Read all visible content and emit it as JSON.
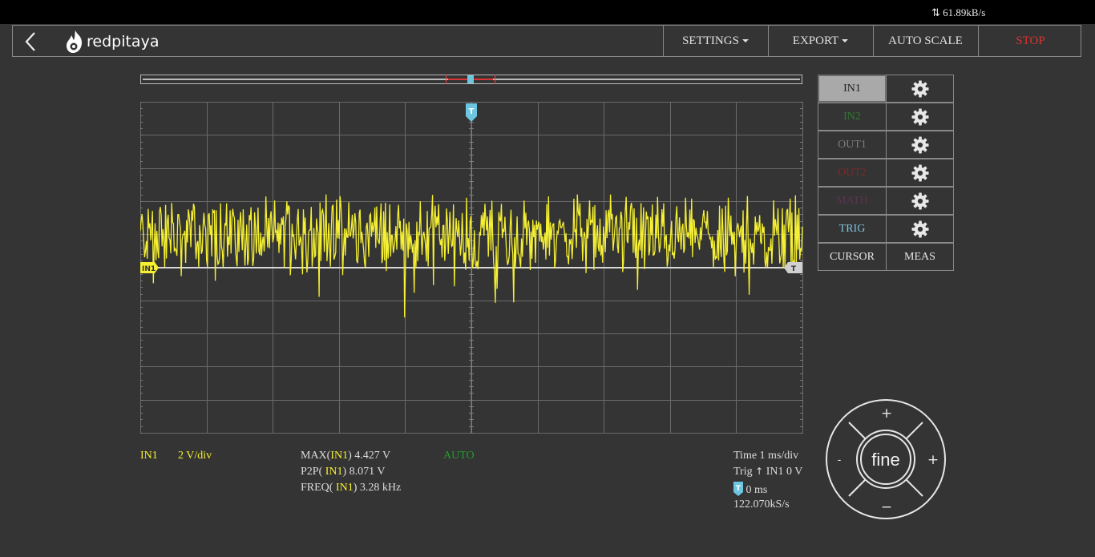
{
  "status": {
    "net_rate": "61.89kB/s"
  },
  "header": {
    "logo_text": "redpitaya",
    "buttons": {
      "settings": "SETTINGS",
      "export": "EXPORT",
      "auto_scale": "AUTO SCALE",
      "stop": "STOP"
    }
  },
  "channels": [
    {
      "label": "IN1",
      "color": "#222222",
      "active": true
    },
    {
      "label": "IN2",
      "color": "#2f7a2f",
      "active": false
    },
    {
      "label": "OUT1",
      "color": "#7c7c7c",
      "active": false
    },
    {
      "label": "OUT2",
      "color": "#7a2a2a",
      "active": false
    },
    {
      "label": "MATH",
      "color": "#5a3550",
      "active": false
    },
    {
      "label": "TRIG",
      "color": "#7fc4e0",
      "active": false
    }
  ],
  "panel": {
    "cursor": "CURSOR",
    "meas": "MEAS"
  },
  "markers": {
    "trigger": "T",
    "channel_marker": "IN1",
    "trig_level_marker": "T"
  },
  "bottom": {
    "ch_name": "IN1",
    "ch_scale": "2  V/div",
    "meas": {
      "max_prefix": "MAX(",
      "max_ch": "IN1",
      "max_value": ") 4.427  V",
      "p2p_prefix": "P2P( ",
      "p2p_ch": "IN1",
      "p2p_value": ") 8.071  V",
      "freq_prefix": "FREQ( ",
      "freq_ch": "IN1",
      "freq_value": ") 3.28  kHz"
    },
    "trigger_mode": "AUTO",
    "time": "Time  1  ms/div",
    "trig_prefix": "Trig",
    "trig_source": "IN1  0  V",
    "trig_delay": "0  ms",
    "sample_rate": "122.070kS/s"
  },
  "jog": {
    "center": "fine",
    "up": "+",
    "down": "−",
    "left": "-",
    "right": "+"
  },
  "colors": {
    "signal": "#f5f032",
    "accent": "#6cc6e0",
    "stop": "#e03030",
    "grid": "#6a6a6a"
  }
}
